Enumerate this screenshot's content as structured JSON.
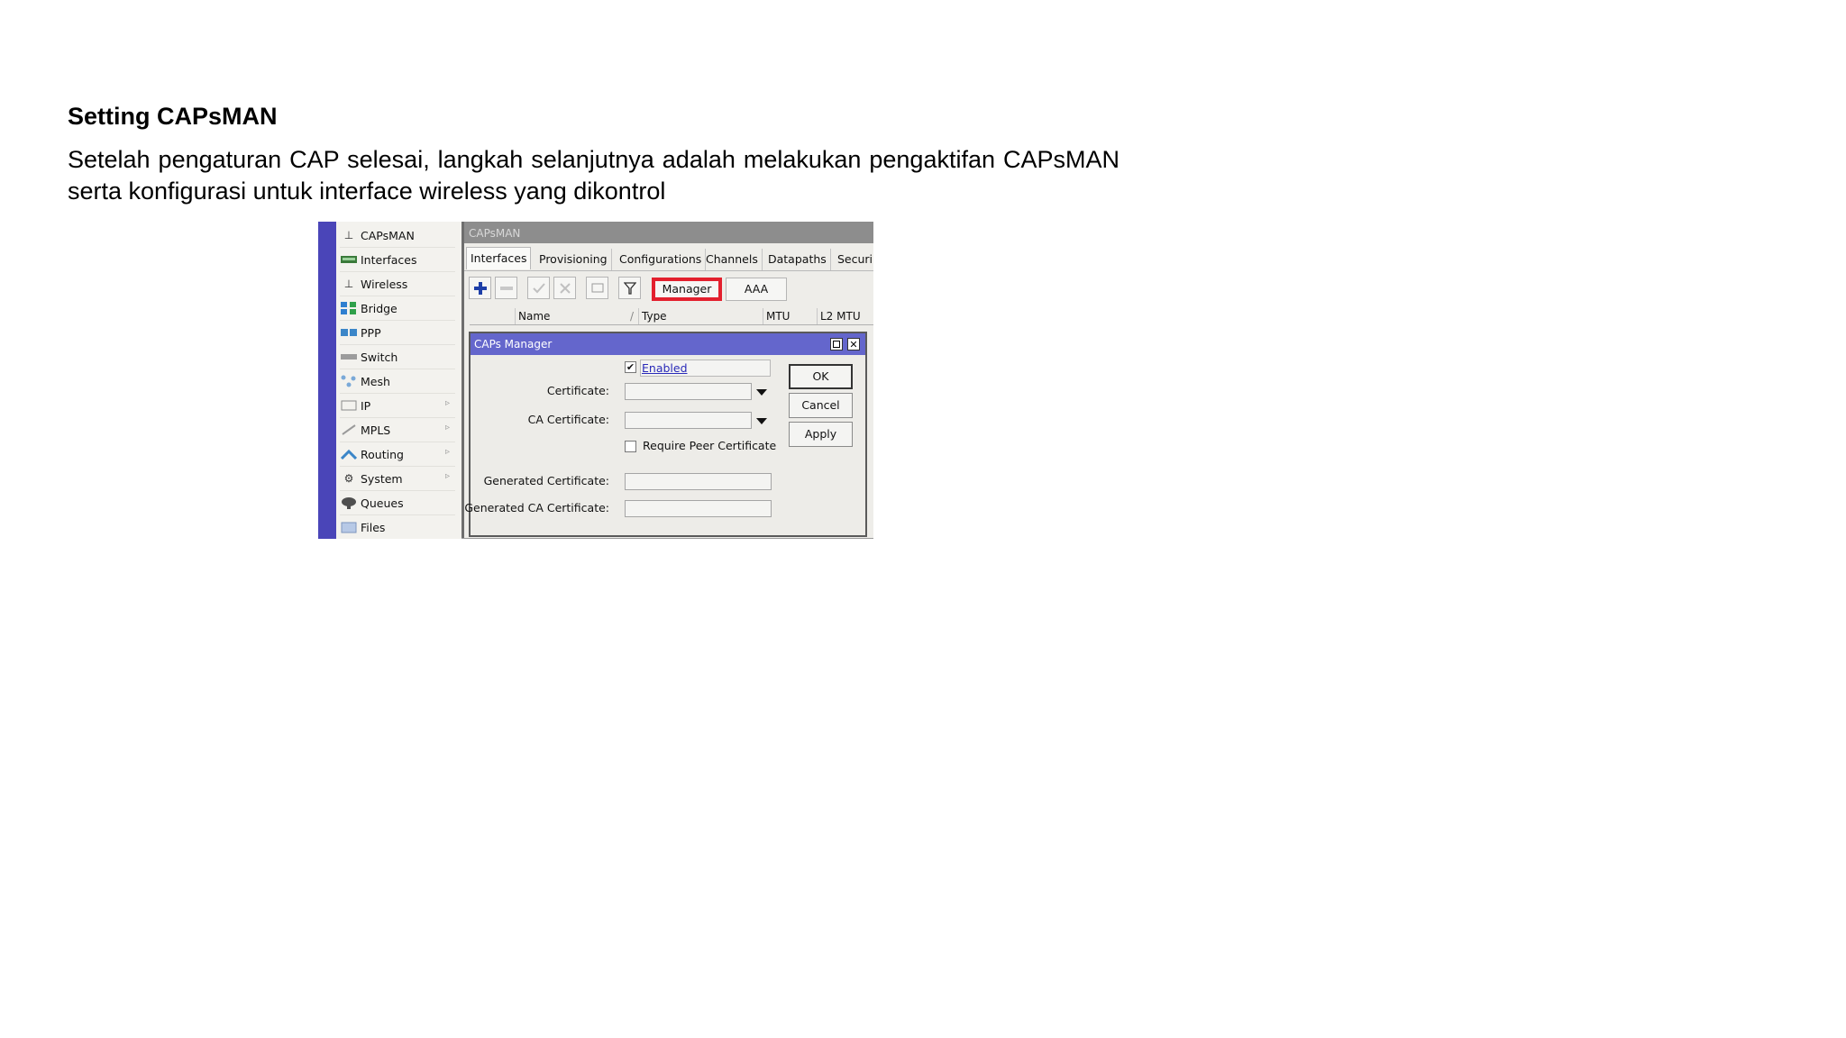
{
  "doc": {
    "heading": "Setting CAPsMAN",
    "paragraph": "Setelah pengaturan CAP selesai, langkah selanjutnya adalah melakukan pengaktifan CAPsMAN serta konfigurasi untuk interface wireless yang dikontrol"
  },
  "sidebar": {
    "items": [
      {
        "label": "CAPsMAN",
        "icon": "antenna-icon"
      },
      {
        "label": "Interfaces",
        "icon": "interfaces-icon"
      },
      {
        "label": "Wireless",
        "icon": "antenna-icon"
      },
      {
        "label": "Bridge",
        "icon": "bridge-icon"
      },
      {
        "label": "PPP",
        "icon": "ppp-icon"
      },
      {
        "label": "Switch",
        "icon": "switch-icon"
      },
      {
        "label": "Mesh",
        "icon": "mesh-icon"
      },
      {
        "label": "IP",
        "icon": "ip-icon",
        "submenu": true
      },
      {
        "label": "MPLS",
        "icon": "mpls-icon",
        "submenu": true
      },
      {
        "label": "Routing",
        "icon": "routing-icon",
        "submenu": true
      },
      {
        "label": "System",
        "icon": "system-gear-icon",
        "submenu": true
      },
      {
        "label": "Queues",
        "icon": "queues-icon"
      },
      {
        "label": "Files",
        "icon": "files-folder-icon"
      }
    ]
  },
  "window": {
    "title": "CAPsMAN",
    "tabs": [
      "Interfaces",
      "Provisioning",
      "Configurations",
      "Channels",
      "Datapaths",
      "Securi"
    ],
    "active_tab": "Interfaces",
    "toolbar": {
      "manager_label": "Manager",
      "aaa_label": "AAA"
    },
    "columns": [
      "Name",
      "Type",
      "MTU",
      "L2 MTU"
    ]
  },
  "dialog": {
    "title": "CAPs Manager",
    "enabled_label": "Enabled",
    "enabled_checked": true,
    "certificate_label": "Certificate:",
    "ca_certificate_label": "CA Certificate:",
    "require_peer_label": "Require Peer Certificate",
    "require_peer_checked": false,
    "generated_certificate_label": "Generated Certificate:",
    "generated_ca_certificate_label": "Generated CA Certificate:",
    "ok_label": "OK",
    "cancel_label": "Cancel",
    "apply_label": "Apply"
  },
  "colors": {
    "highlight": "#e3202e",
    "dialog_title": "#6466cc",
    "sidebar_bar": "#4a45b8"
  }
}
